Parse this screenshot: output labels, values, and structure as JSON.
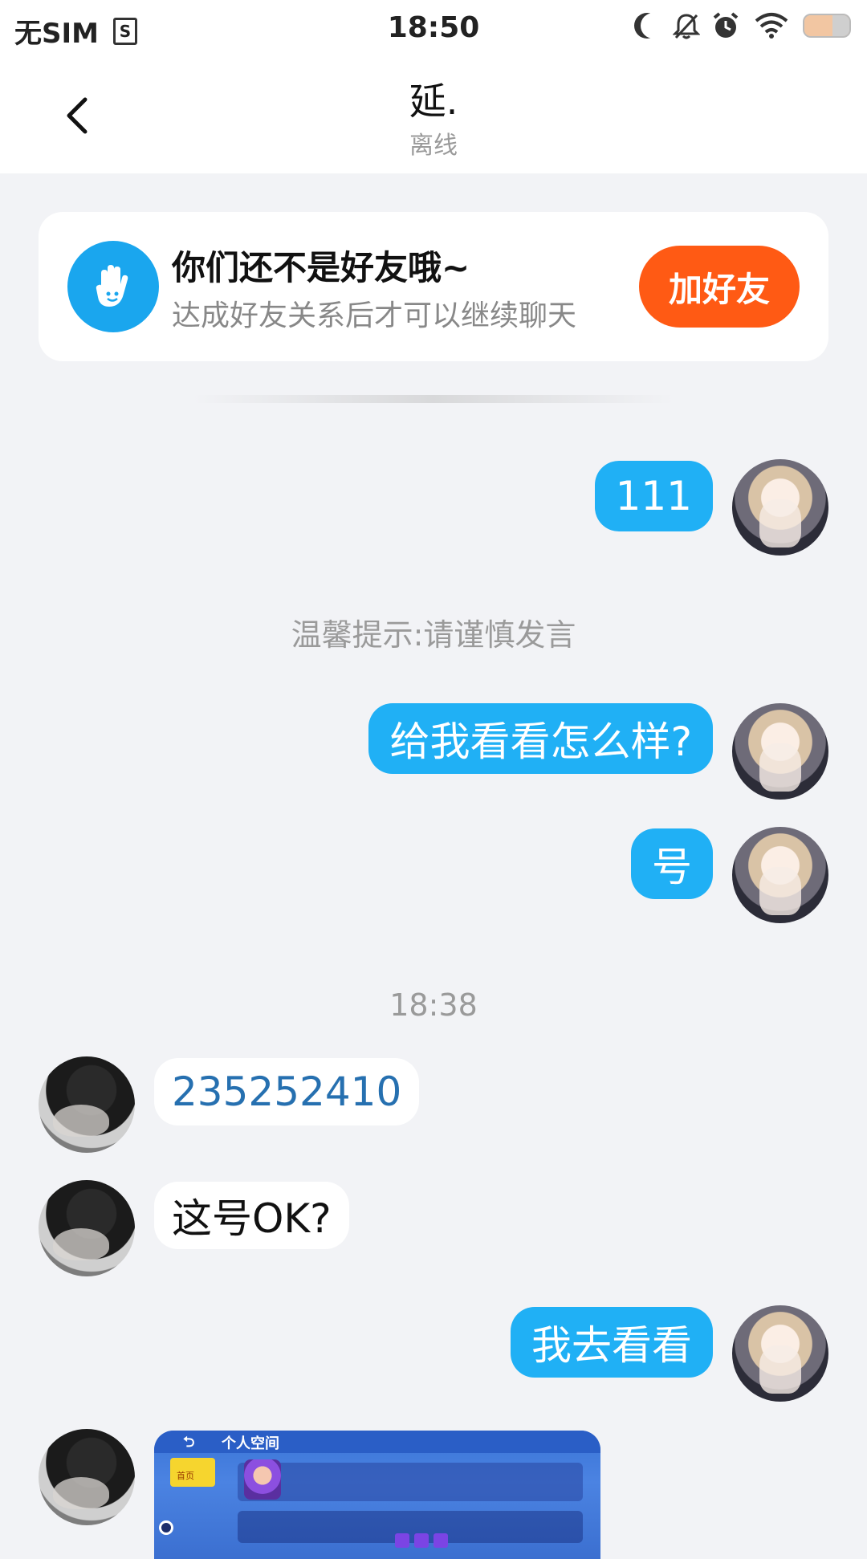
{
  "status_bar": {
    "carrier": "无SIM",
    "sim_icon_letter": "S",
    "time": "18:50",
    "icons": [
      "moon-icon",
      "bell-off-icon",
      "alarm-icon",
      "wifi-icon",
      "battery-icon"
    ]
  },
  "header": {
    "title": "延.",
    "subtitle": "离线"
  },
  "banner": {
    "title": "你们还不是好友哦~",
    "subtitle": "达成好友关系后才可以继续聊天",
    "button_label": "加好友",
    "icon": "hand-icon",
    "button_color": "#ff5a14"
  },
  "messages": [
    {
      "side": "out",
      "text": "111"
    },
    {
      "type": "tip",
      "text": "温馨提示:请谨慎发言"
    },
    {
      "side": "out",
      "text": "给我看看怎么样?"
    },
    {
      "side": "out",
      "text": "号"
    },
    {
      "type": "time",
      "text": "18:38"
    },
    {
      "side": "in",
      "text": "235252410"
    },
    {
      "side": "in",
      "text": "这号OK?"
    },
    {
      "side": "out",
      "text": "我去看看"
    },
    {
      "side": "in",
      "type": "image",
      "caption": "个人空间",
      "nav_label": "首页"
    }
  ],
  "colors": {
    "bubble_out": "#20b0f5",
    "bubble_in": "#ffffff",
    "background": "#f2f3f6"
  }
}
